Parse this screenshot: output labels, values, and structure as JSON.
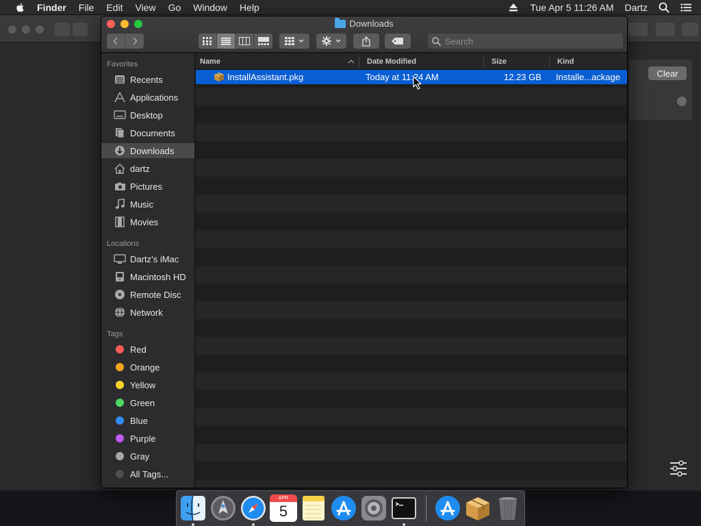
{
  "menubar": {
    "app_name": "Finder",
    "items": [
      "File",
      "Edit",
      "View",
      "Go",
      "Window",
      "Help"
    ],
    "clock": "Tue Apr 5  11:26 AM",
    "user": "Dartz"
  },
  "background_window": {
    "clear_label": "Clear"
  },
  "finder": {
    "title": "Downloads",
    "search_placeholder": "Search",
    "sidebar": {
      "favorites_header": "Favorites",
      "favorites": [
        {
          "label": "Recents",
          "icon": "recents-icon"
        },
        {
          "label": "Applications",
          "icon": "applications-icon"
        },
        {
          "label": "Desktop",
          "icon": "desktop-icon"
        },
        {
          "label": "Documents",
          "icon": "documents-icon"
        },
        {
          "label": "Downloads",
          "icon": "downloads-icon",
          "selected": true
        },
        {
          "label": "dartz",
          "icon": "home-icon"
        },
        {
          "label": "Pictures",
          "icon": "pictures-icon"
        },
        {
          "label": "Music",
          "icon": "music-icon"
        },
        {
          "label": "Movies",
          "icon": "movies-icon"
        }
      ],
      "locations_header": "Locations",
      "locations": [
        {
          "label": "Dartz’s iMac",
          "icon": "imac-icon"
        },
        {
          "label": "Macintosh HD",
          "icon": "hard-drive-icon"
        },
        {
          "label": "Remote Disc",
          "icon": "disc-icon"
        },
        {
          "label": "Network",
          "icon": "network-icon"
        }
      ],
      "tags_header": "Tags",
      "tags": [
        {
          "label": "Red",
          "color": "#fb5c5a"
        },
        {
          "label": "Orange",
          "color": "#f5a623"
        },
        {
          "label": "Yellow",
          "color": "#f7d32b"
        },
        {
          "label": "Green",
          "color": "#4cd964"
        },
        {
          "label": "Blue",
          "color": "#2f8cf0"
        },
        {
          "label": "Purple",
          "color": "#bf5af2"
        },
        {
          "label": "Gray",
          "color": "#a7a7a9"
        },
        {
          "label": "All Tags...",
          "color": "#4e4e50"
        }
      ]
    },
    "columns": {
      "name": "Name",
      "date_modified": "Date Modified",
      "size": "Size",
      "kind": "Kind"
    },
    "files": [
      {
        "name": "InstallAssistant.pkg",
        "date_modified": "Today at 11:24 AM",
        "size": "12.23 GB",
        "kind": "Installe...ackage",
        "selected": true
      }
    ]
  },
  "dock": {
    "calendar_month": "APR",
    "calendar_day": "5",
    "apps": [
      "finder",
      "launchpad",
      "safari",
      "calendar",
      "notes",
      "app-store",
      "system-preferences",
      "terminal",
      "app-store-downloads",
      "installer",
      "trash"
    ]
  },
  "colors": {
    "selection": "#0a5ed3",
    "sidebar_selected": "#4a4a4d"
  }
}
